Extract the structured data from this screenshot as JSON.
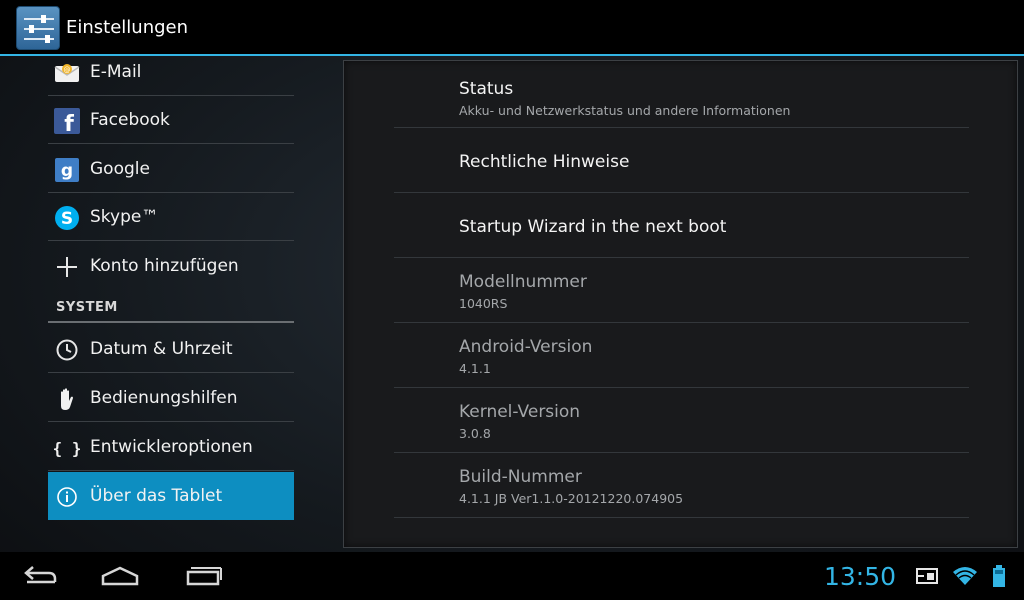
{
  "action_bar": {
    "title": "Einstellungen",
    "icon": "settings-sliders-icon"
  },
  "accounts": [
    {
      "label": "E-Mail",
      "icon": "email-icon"
    },
    {
      "label": "Facebook",
      "icon": "facebook-icon"
    },
    {
      "label": "Google",
      "icon": "google-icon"
    },
    {
      "label": "Skype™",
      "icon": "skype-icon"
    },
    {
      "label": "Konto hinzufügen",
      "icon": "plus-icon"
    }
  ],
  "system_section": {
    "header": "SYSTEM",
    "items": [
      {
        "label": "Datum & Uhrzeit",
        "icon": "clock-icon"
      },
      {
        "label": "Bedienungshilfen",
        "icon": "hand-icon"
      },
      {
        "label": "Entwickleroptionen",
        "icon": "braces-icon"
      },
      {
        "label": "Über das Tablet",
        "icon": "info-icon",
        "selected": true
      }
    ]
  },
  "about": {
    "status": {
      "title": "Status",
      "summary": "Akku- und Netzwerkstatus und andere Informationen"
    },
    "legal": {
      "title": "Rechtliche Hinweise"
    },
    "wizard": {
      "title": "Startup Wizard in the next boot"
    },
    "model": {
      "title": "Modellnummer",
      "value": "1040RS"
    },
    "android": {
      "title": "Android-Version",
      "value": "4.1.1"
    },
    "kernel": {
      "title": "Kernel-Version",
      "value": "3.0.8"
    },
    "build": {
      "title": "Build-Nummer",
      "value": "4.1.1 JB Ver1.1.0-20121220.074905"
    }
  },
  "nav_bar": {
    "time": "13:50",
    "icons": [
      "back-icon",
      "home-icon",
      "recent-apps-icon",
      "screenshot-icon",
      "wifi-icon",
      "battery-icon"
    ]
  },
  "colors": {
    "accent": "#33b5e5",
    "selected_bg": "#0d8ec1"
  }
}
